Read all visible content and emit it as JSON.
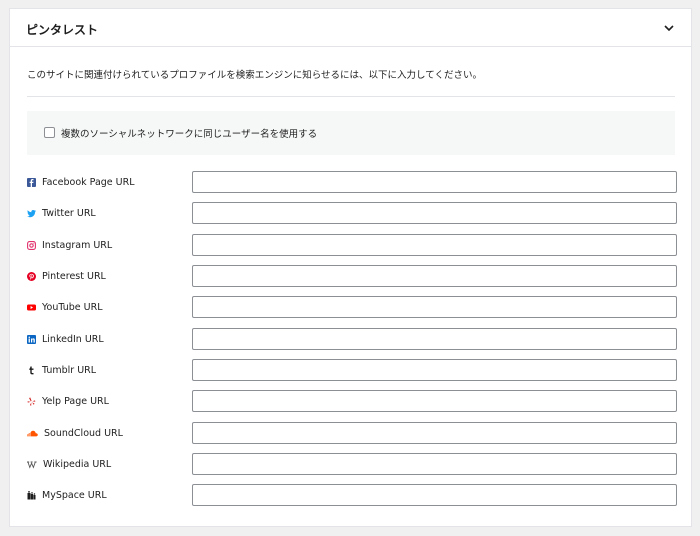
{
  "panel": {
    "title": "ピンタレスト"
  },
  "description": "このサイトに関連付けられているプロファイルを検索エンジンに知らせるには、以下に入力してください。",
  "option": {
    "label": "複数のソーシャルネットワークに同じユーザー名を使用する",
    "checked": false
  },
  "fields": [
    {
      "label": "Facebook Page URL",
      "value": "",
      "icon": "facebook-icon",
      "color": "#3b5998"
    },
    {
      "label": "Twitter URL",
      "value": "",
      "icon": "twitter-icon",
      "color": "#1da1f2"
    },
    {
      "label": "Instagram URL",
      "value": "",
      "icon": "instagram-icon",
      "color": "#e1306c"
    },
    {
      "label": "Pinterest URL",
      "value": "",
      "icon": "pinterest-icon",
      "color": "#e60023"
    },
    {
      "label": "YouTube URL",
      "value": "",
      "icon": "youtube-icon",
      "color": "#ff0000"
    },
    {
      "label": "LinkedIn URL",
      "value": "",
      "icon": "linkedin-icon",
      "color": "#0a66c2"
    },
    {
      "label": "Tumblr URL",
      "value": "",
      "icon": "tumblr-icon",
      "color": "#1e1e1e"
    },
    {
      "label": "Yelp Page URL",
      "value": "",
      "icon": "yelp-icon",
      "color": "#d32323"
    },
    {
      "label": "SoundCloud URL",
      "value": "",
      "icon": "soundcloud-icon",
      "color": "#ff5500"
    },
    {
      "label": "Wikipedia URL",
      "value": "",
      "icon": "wikipedia-icon",
      "color": "#555555"
    },
    {
      "label": "MySpace URL",
      "value": "",
      "icon": "myspace-icon",
      "color": "#1e1e1e"
    }
  ]
}
